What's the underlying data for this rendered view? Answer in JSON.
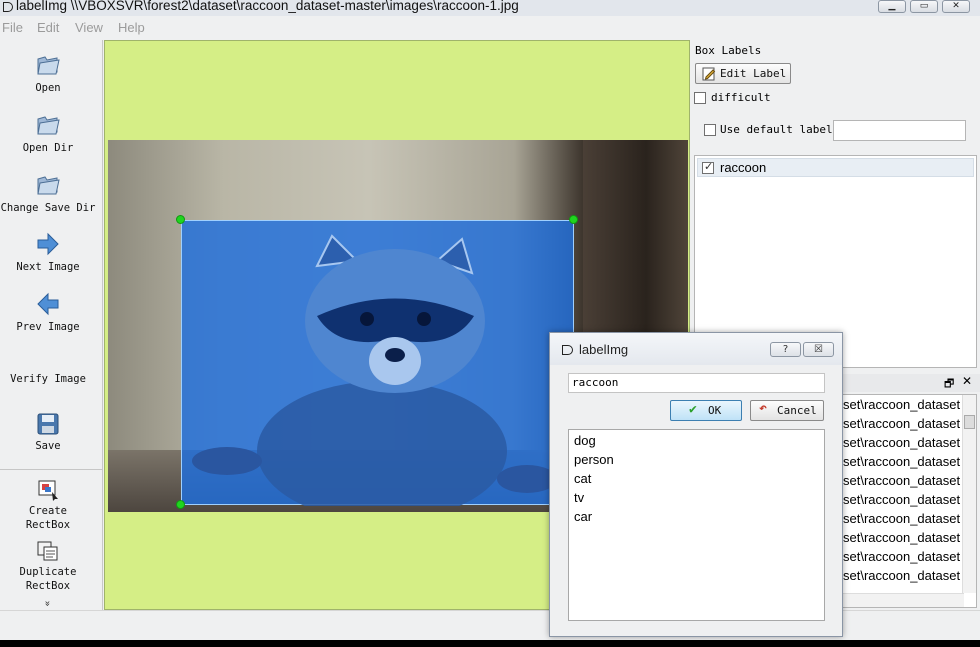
{
  "window": {
    "title": "labelImg \\\\VBOXSVR\\forest2\\dataset\\raccoon_dataset-master\\images\\raccoon-1.jpg",
    "controls": [
      "▁",
      "▭",
      "✕"
    ]
  },
  "menu": [
    "File",
    "Edit",
    "View",
    "Help"
  ],
  "toolbar": {
    "open": "Open",
    "open_dir": "Open Dir",
    "change_save_dir": "Change Save Dir",
    "next_image": "Next Image",
    "prev_image": "Prev Image",
    "verify_image": "Verify Image",
    "save": "Save",
    "create_rectbox": "Create\nRectBox",
    "duplicate_rectbox": "Duplicate\nRectBox",
    "more": "»"
  },
  "panel": {
    "title": "Box Labels",
    "edit_label": "Edit Label",
    "difficult": "difficult",
    "use_default_label": "Use default label",
    "default_label_value": "",
    "labels": [
      {
        "text": "raccoon",
        "checked": true
      }
    ]
  },
  "file_dock": {
    "controls": [
      "🗗",
      "✕"
    ],
    "items": [
      "set\\raccoon_dataset",
      "set\\raccoon_dataset",
      "set\\raccoon_dataset",
      "set\\raccoon_dataset",
      "set\\raccoon_dataset",
      "set\\raccoon_dataset",
      "set\\raccoon_dataset",
      "set\\raccoon_dataset",
      "set\\raccoon_dataset",
      "set\\raccoon_dataset"
    ]
  },
  "dialog": {
    "title": "labelImg",
    "help_btn": "?",
    "close_btn": "☒",
    "input_value": "raccoon",
    "ok_label": "OK",
    "cancel_label": "Cancel",
    "options": [
      "dog",
      "person",
      "cat",
      "tv",
      "car"
    ]
  },
  "colors": {
    "canvas_bg": "#d5ee86",
    "bbox_fill": "#1e6edc",
    "handle": "#1fd51f"
  }
}
